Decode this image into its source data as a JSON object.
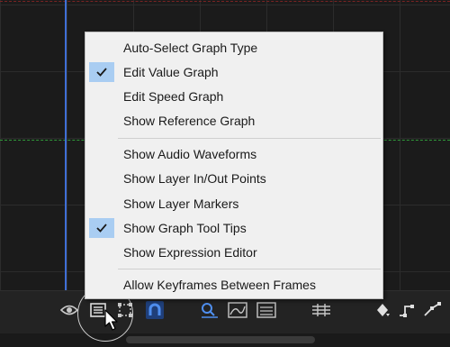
{
  "menu": {
    "groups": [
      [
        {
          "label": "Auto-Select Graph Type",
          "checked": false
        },
        {
          "label": "Edit Value Graph",
          "checked": true
        },
        {
          "label": "Edit Speed Graph",
          "checked": false
        },
        {
          "label": "Show Reference Graph",
          "checked": false
        }
      ],
      [
        {
          "label": "Show Audio Waveforms",
          "checked": false
        },
        {
          "label": "Show Layer In/Out Points",
          "checked": false
        },
        {
          "label": "Show Layer Markers",
          "checked": false
        },
        {
          "label": "Show Graph Tool Tips",
          "checked": true
        },
        {
          "label": "Show Expression Editor",
          "checked": false
        }
      ],
      [
        {
          "label": "Allow Keyframes Between Frames",
          "checked": false
        }
      ]
    ]
  },
  "toolbar": {
    "buttons": [
      {
        "icon": "eye-icon"
      },
      {
        "icon": "graph-options-icon"
      },
      {
        "icon": "transform-box-icon"
      },
      {
        "icon": "snap-magnet-icon"
      },
      {
        "icon": "fit-selection-icon"
      },
      {
        "icon": "fit-all-graphs-icon"
      },
      {
        "icon": "fit-all-icon"
      },
      {
        "icon": "separate-dimensions-icon"
      },
      {
        "icon": "keyframe-diamond-icon"
      },
      {
        "icon": "convert-hold-icon"
      },
      {
        "icon": "easy-ease-icon"
      }
    ]
  },
  "colors": {
    "menu_bg": "#f0f0f0",
    "check_highlight": "#a9cdf2",
    "accent_blue": "#4f8ff0",
    "playhead": "#3f6fd6",
    "reference_line": "#2f9a39"
  }
}
